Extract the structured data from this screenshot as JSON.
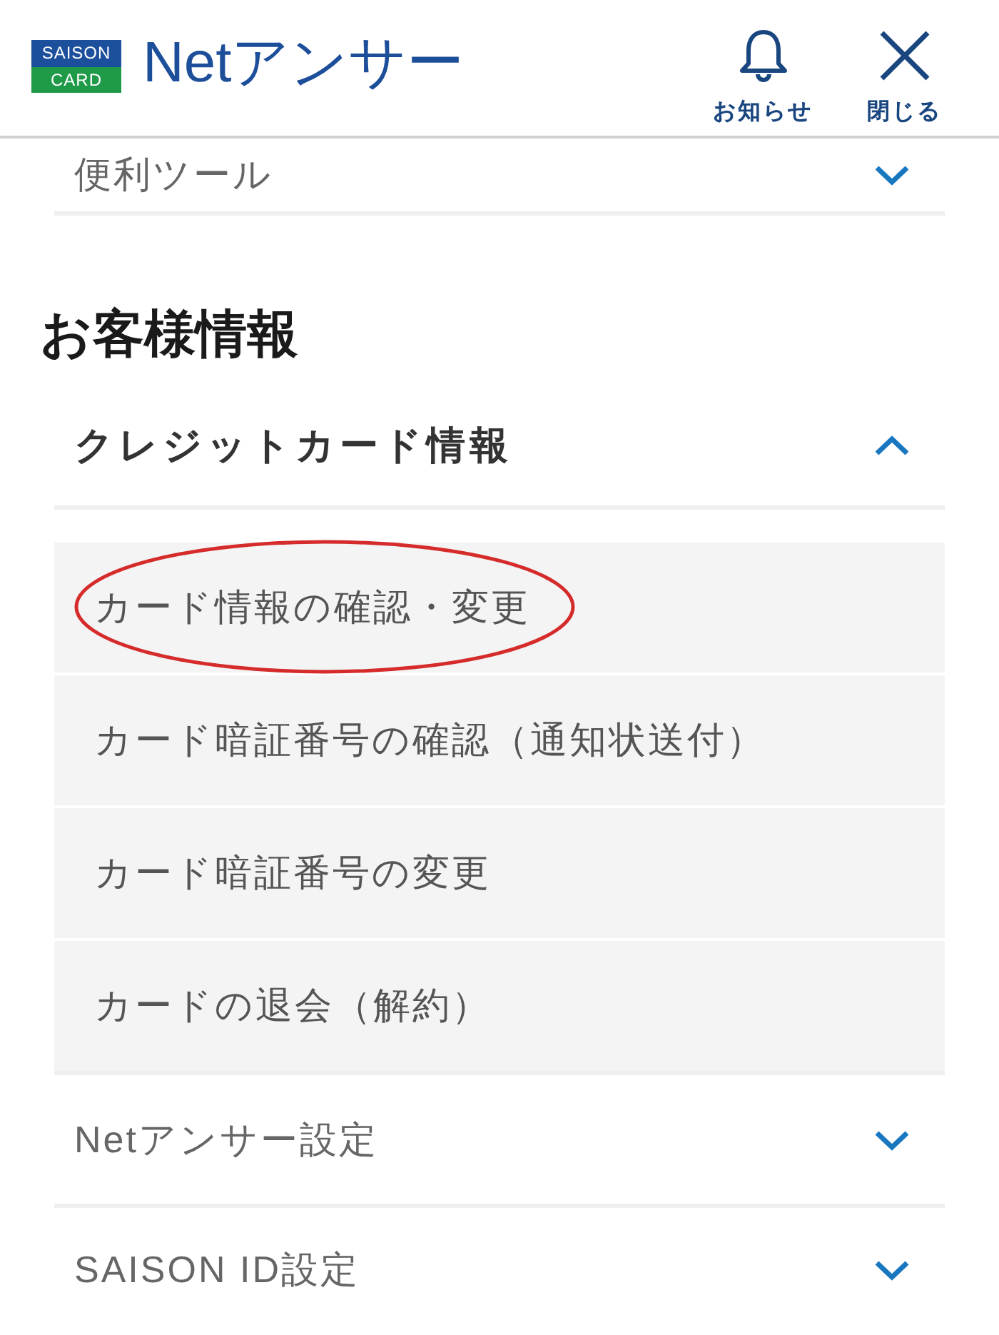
{
  "header": {
    "logo": {
      "line_1": "SAISON",
      "line_2": "CARD"
    },
    "title": "Netアンサー",
    "actions": [
      {
        "kind": "bell",
        "label": "お知らせ"
      },
      {
        "kind": "close",
        "label": "閉じる"
      }
    ]
  },
  "menu": [
    {
      "kind": "row",
      "label": "便利ツール",
      "expanded": false
    },
    {
      "kind": "heading",
      "label": "お客様情報"
    },
    {
      "kind": "row",
      "label": "クレジットカード情報",
      "expanded": true,
      "children": [
        {
          "label": "カード情報の確認・変更",
          "circled": true
        },
        {
          "label": "カード暗証番号の確認（通知状送付）",
          "circled": false
        },
        {
          "label": "カード暗証番号の変更",
          "circled": false
        },
        {
          "label": "カードの退会（解約）",
          "circled": false
        }
      ]
    },
    {
      "kind": "row",
      "label": "Netアンサー設定",
      "expanded": false
    },
    {
      "kind": "row",
      "label": "SAISON ID設定",
      "expanded": false
    }
  ]
}
